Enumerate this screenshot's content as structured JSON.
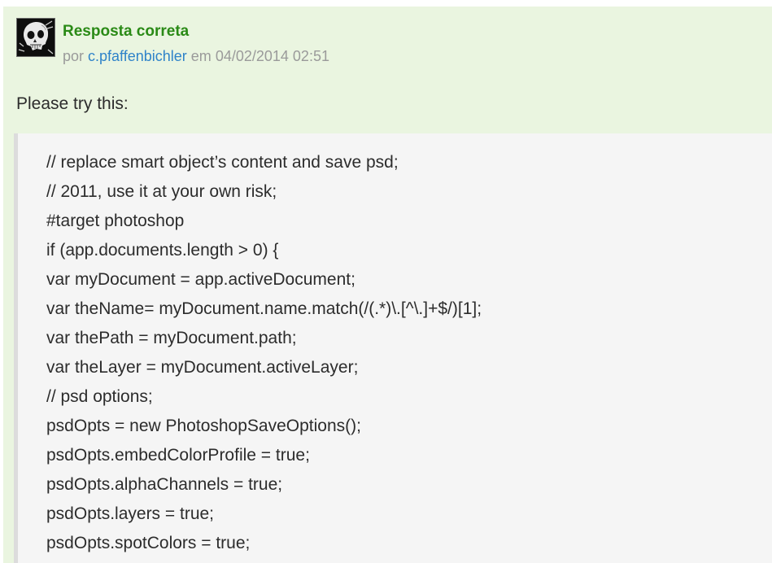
{
  "answer": {
    "badge": "Resposta correta",
    "byline": {
      "prefix": "por",
      "author": "c.pfaffenbichler",
      "between": "em",
      "datetime": "04/02/2014 02:51"
    },
    "intro": "Please try this:",
    "code_lines": [
      "// replace smart object’s content and save psd;",
      "// 2011, use it at your own risk;",
      "#target photoshop",
      "if (app.documents.length > 0) {",
      "var myDocument = app.activeDocument;",
      "var theName= myDocument.name.match(/(.*)\\.[^\\.]+$/)[1];",
      "var thePath = myDocument.path;",
      "var theLayer = myDocument.activeLayer;",
      "// psd options;",
      "psdOpts = new PhotoshopSaveOptions();",
      "psdOpts.embedColorProfile = true;",
      "psdOpts.alphaChannels = true;",
      "psdOpts.layers = true;",
      "psdOpts.spotColors = true;"
    ]
  },
  "colors": {
    "answer_background": "#eaf5e0",
    "badge_text": "#2a8a16",
    "link": "#2f83c9",
    "meta_text": "#9a9a9a",
    "code_background": "#f5f5f5"
  },
  "icons": {
    "avatar": "skull-avatar"
  }
}
